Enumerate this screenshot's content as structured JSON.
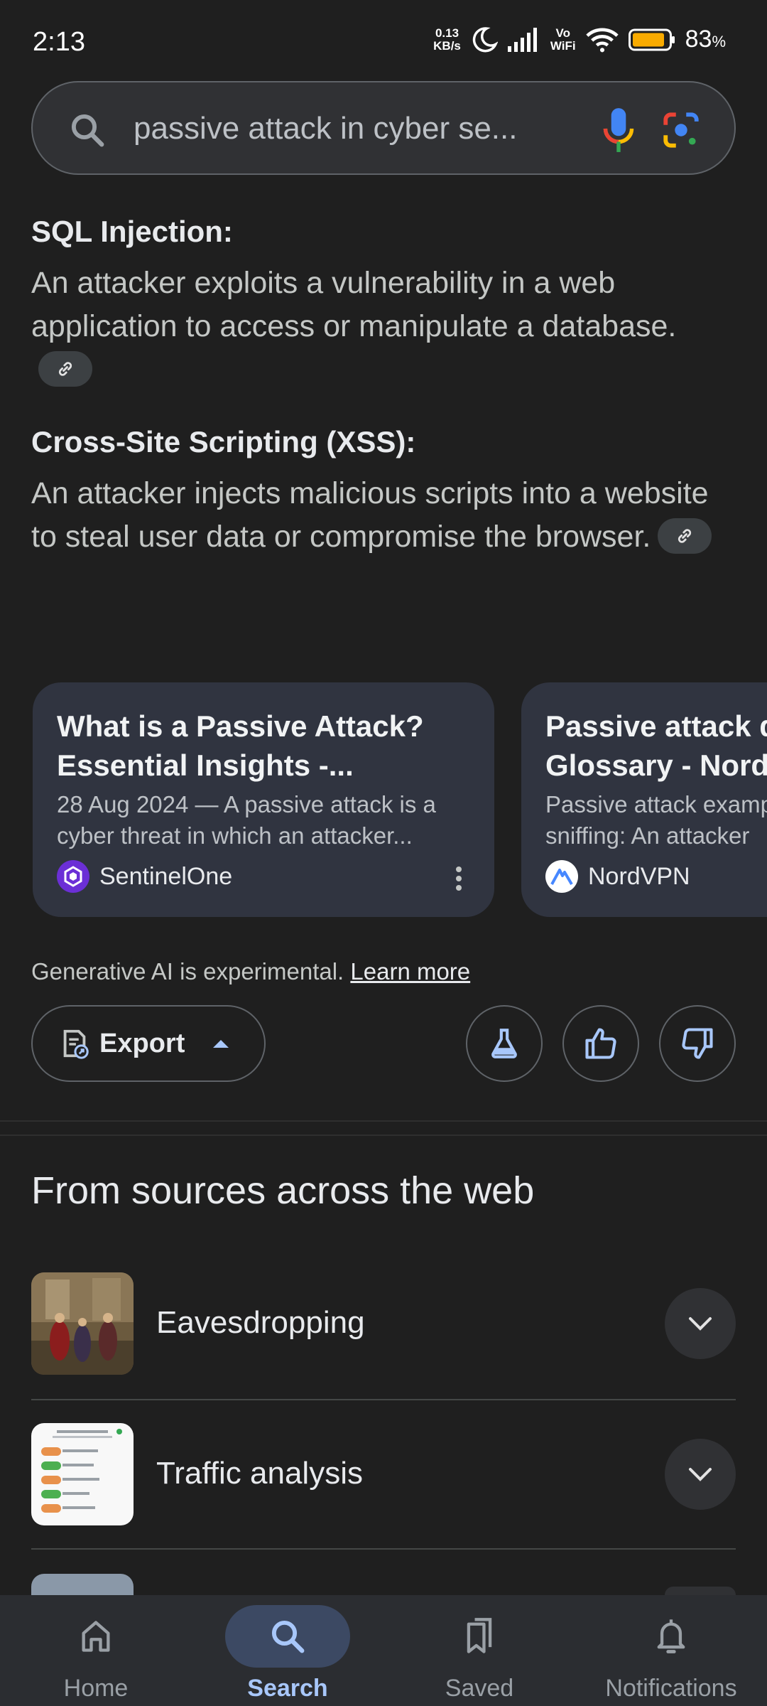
{
  "status_bar": {
    "time": "2:13",
    "net_speed_value": "0.13",
    "net_speed_unit": "KB/s",
    "vowifi_top": "Vo",
    "vowifi_bottom": "WiFi",
    "battery_percent": "83",
    "battery_unit": "%"
  },
  "search": {
    "query": "passive attack in cyber se..."
  },
  "ai_overview": {
    "items": [
      {
        "heading": "SQL Injection:",
        "text": "An attacker exploits a vulnerability in a web application to access or manipulate a database."
      },
      {
        "heading": "Cross-Site Scripting (XSS):",
        "text": "An attacker injects malicious scripts into a website to steal user data or compromise the browser."
      }
    ],
    "cards": [
      {
        "title": "What is a Passive Attack? Essential Insights -...",
        "snippet": "28 Aug 2024 — A passive attack is a cyber threat in which an attacker...",
        "source": "SentinelOne"
      },
      {
        "title": "Passive attack d Glossary - Nord",
        "snippet": "Passive attack examp sniffing: An attacker",
        "source": "NordVPN"
      }
    ],
    "disclaimer": "Generative AI is experimental.",
    "learn_more": "Learn more",
    "export_label": "Export"
  },
  "web_sources": {
    "title": "From sources across the web",
    "items": [
      {
        "label": "Eavesdropping"
      },
      {
        "label": "Traffic analysis"
      }
    ]
  },
  "bottom_nav": {
    "items": [
      {
        "label": "Home"
      },
      {
        "label": "Search"
      },
      {
        "label": "Saved"
      },
      {
        "label": "Notifications"
      }
    ],
    "active": "Search"
  },
  "colors": {
    "background": "#1f1f1f",
    "card": "#303440",
    "accent": "#a8c7fa",
    "active_pill": "#3c4963"
  }
}
